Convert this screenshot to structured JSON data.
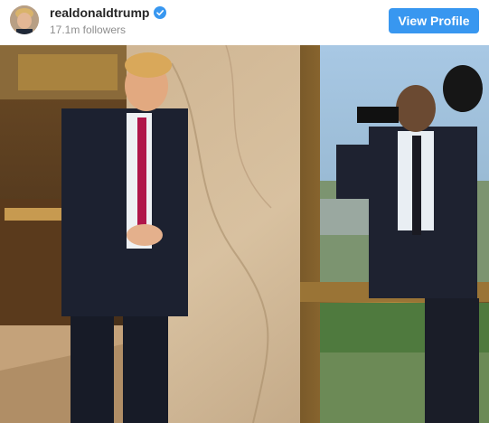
{
  "profile": {
    "username": "realdonaldtrump",
    "followers": "17.1m followers",
    "verified_icon": "verified-badge-icon",
    "view_profile_label": "View Profile"
  },
  "colors": {
    "accent": "#3897f0",
    "username": "#262626",
    "secondary_text": "#8e8e8e"
  },
  "post": {
    "photo_subject": "post-photo"
  }
}
